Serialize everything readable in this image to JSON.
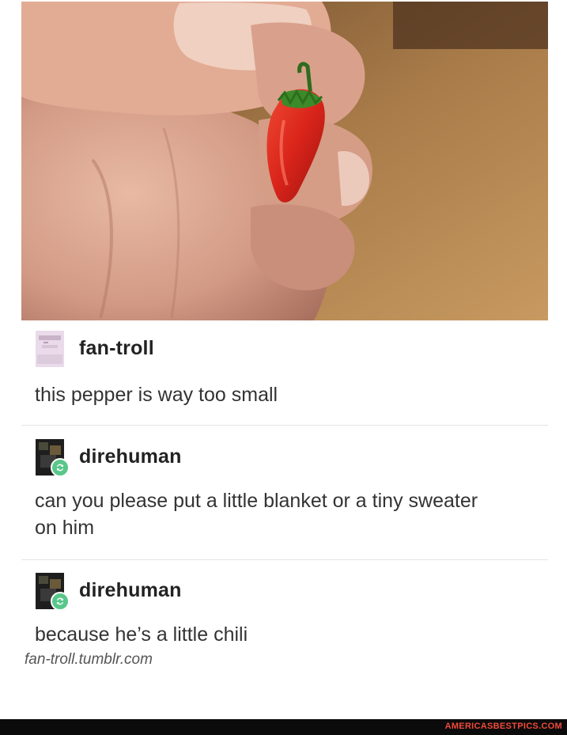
{
  "post": {
    "photo_icon": "chili-pepper-photo",
    "entries": [
      {
        "username": "fan-troll",
        "text": "this pepper is way too small",
        "avatar_icon": "pastel-avatar-icon"
      },
      {
        "username": "direhuman",
        "text": "can you please put a little blanket or a tiny sweater on him",
        "avatar_icon": "dark-avatar-icon",
        "badge_icon": "reblog-icon"
      },
      {
        "username": "direhuman",
        "text": "because he’s a little chili",
        "avatar_icon": "dark-avatar-icon",
        "badge_icon": "reblog-icon"
      }
    ],
    "source": "fan-troll.tumblr.com"
  },
  "footer": {
    "watermark": "AMERICASBESTPICS.COM"
  },
  "colors": {
    "reblog_badge": "#59c68a",
    "watermark": "#f04a3a",
    "footer_bar": "#0b0b0b",
    "pepper": "#d9241a"
  }
}
